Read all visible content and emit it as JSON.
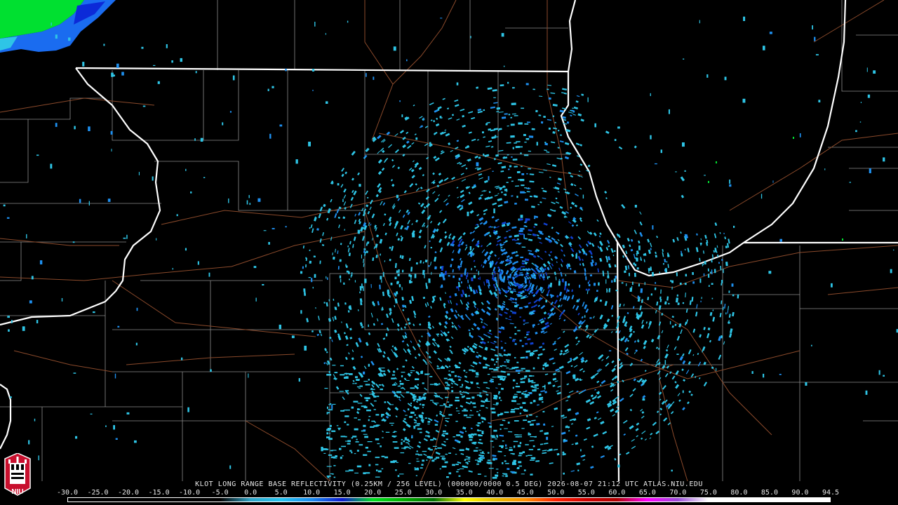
{
  "product": {
    "station": "KLOT",
    "title_line": "KLOT LONG RANGE BASE REFLECTIVITY (0.25KM / 256 LEVEL) (000000/0000 0.5 DEG) 2026-08-07 21:12 UTC  ATLAS.NIU.EDU"
  },
  "scale": {
    "labels": [
      "-30.0",
      "-25.0",
      "-20.0",
      "-15.0",
      "-10.0",
      "-5.0",
      "0.0",
      "5.0",
      "10.0",
      "15.0",
      "20.0",
      "25.0",
      "30.0",
      "35.0",
      "40.0",
      "45.0",
      "50.0",
      "55.0",
      "60.0",
      "65.0",
      "70.0",
      "75.0",
      "80.0",
      "85.0",
      "90.0",
      "94.5"
    ],
    "colors": [
      "#000000",
      "#000000",
      "#000000",
      "#000000",
      "#000000",
      "#000000",
      "#2fa6c9",
      "#25c4f0",
      "#1a8cf0",
      "#0c1ad0",
      "#00e020",
      "#00b000",
      "#006f00",
      "#ffff00",
      "#e8c000",
      "#ff9000",
      "#ff2000",
      "#d00000",
      "#b00000",
      "#ff00ff",
      "#9a4cd8",
      "#ffffff",
      "#ffffff",
      "#ffffff",
      "#ffffff",
      "#ffffff"
    ]
  },
  "logo": {
    "text": "NIU",
    "colors": {
      "red": "#c8102e",
      "black": "#000000",
      "white": "#ffffff"
    }
  },
  "map_colors": {
    "state_border": "#ffffff",
    "county_line": "#8c8c8c",
    "highway": "#8b4a2b",
    "echo_light": "#2ec5e6",
    "echo_mid": "#1e90f0",
    "echo_dark": "#1040d0",
    "echo_green": "#00e030"
  }
}
